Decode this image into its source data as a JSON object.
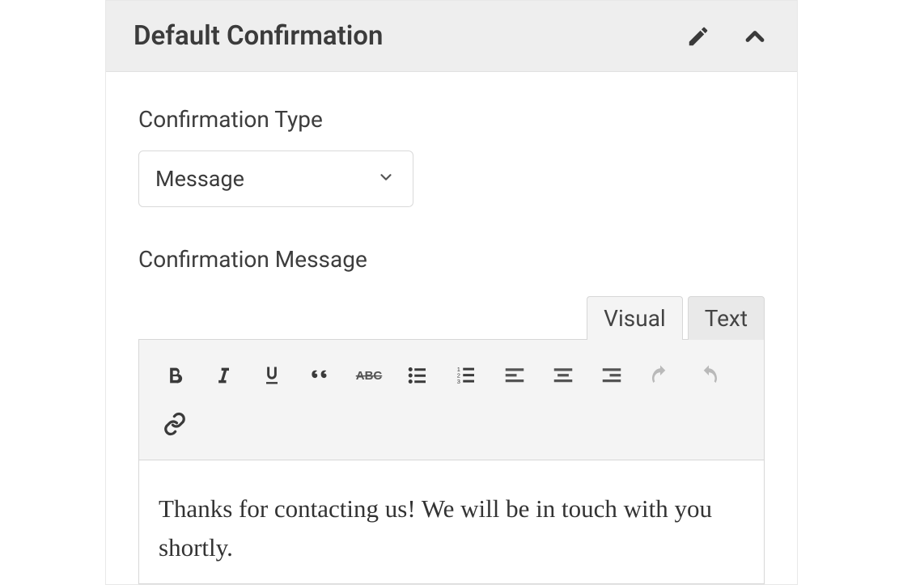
{
  "header": {
    "title": "Default Confirmation"
  },
  "fields": {
    "type_label": "Confirmation Type",
    "type_value": "Message",
    "message_label": "Confirmation Message"
  },
  "editor": {
    "tabs": {
      "visual": "Visual",
      "text": "Text",
      "active": "visual"
    },
    "content": "Thanks for contacting us! We will be in touch with you shortly."
  }
}
